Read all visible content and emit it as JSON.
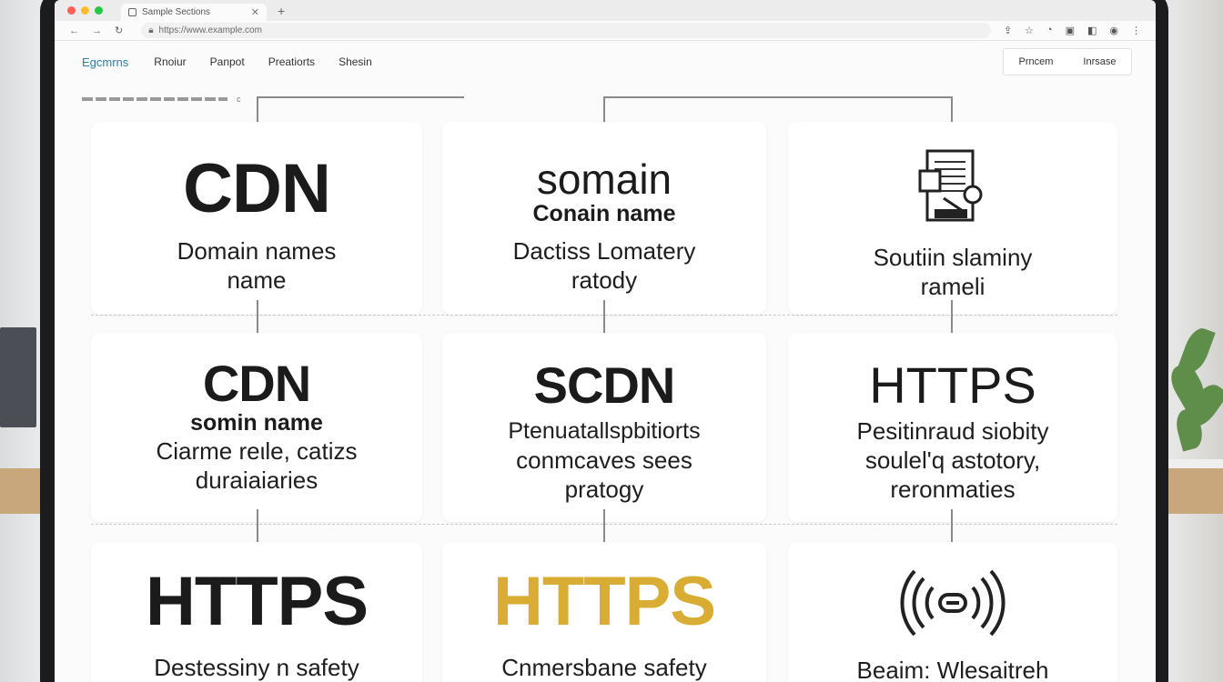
{
  "browser": {
    "tab_title": "Sample Sections",
    "url": "https://www.example.com",
    "colors": {
      "close": "#ff5f57",
      "minimize": "#febc2e",
      "maximize": "#28c840"
    },
    "toolbar_icons": [
      "back-icon",
      "forward-icon",
      "reload-icon",
      "star-icon",
      "extension-icon",
      "download-icon",
      "menu-icon"
    ]
  },
  "site": {
    "logo": "Egcmrns",
    "nav": [
      "Rnoiur",
      "Panpot",
      "Preatiorts",
      "Shesin"
    ],
    "buttons": [
      "Prncem",
      "Inrsase"
    ]
  },
  "breadcrumb": "c",
  "cards": [
    {
      "title": "CDN",
      "subtitle": "",
      "text": [
        "Domain names",
        "name"
      ]
    },
    {
      "title": "somain",
      "subtitle": "Conain name",
      "text": [
        "Dactiss Lomatery",
        "ratody"
      ]
    },
    {
      "title": "",
      "subtitle": "",
      "icon": "document-search-icon",
      "text": [
        "Soutiin slaminy",
        "rameli"
      ]
    },
    {
      "title": "CDN",
      "subtitle": "somin name",
      "text": [
        "Ciarme reιle, catizs",
        "duraiaiaries"
      ]
    },
    {
      "title": "SCDN",
      "subtitle": "",
      "text": [
        "Ptenuatallspbitiorts",
        "conmcaves sees",
        "pratogy"
      ]
    },
    {
      "title": "HTTPS",
      "subtitle": "",
      "text": [
        "Pesitinraud siobity",
        "soulel'q astotory,",
        "reronmaties"
      ]
    },
    {
      "title": "HTTPS",
      "subtitle": "",
      "text": [
        "Destessiny n safety"
      ]
    },
    {
      "title": "HTTPS",
      "subtitle": "",
      "color": "#d9ad34",
      "text": [
        "Cnmersbane safety"
      ]
    },
    {
      "title": "",
      "subtitle": "",
      "icon": "signal-icon",
      "text": [
        "Beaim: Wlesaitreh"
      ]
    }
  ]
}
